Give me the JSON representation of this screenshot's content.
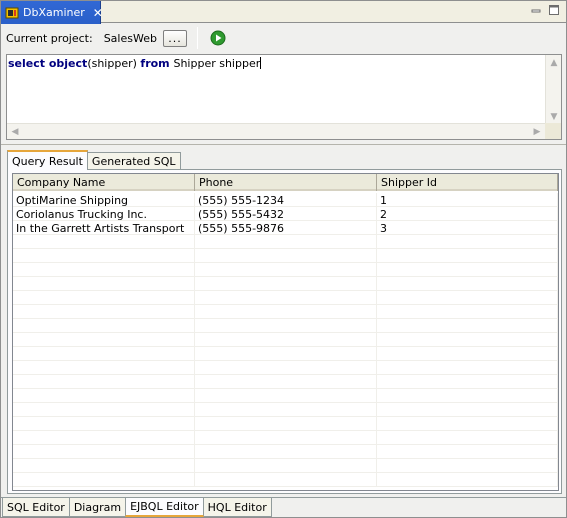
{
  "view": {
    "title": "DbXaminer",
    "close_glyph": "✕"
  },
  "toolbar": {
    "project_label": "Current project:",
    "project_name": "SalesWeb",
    "browse_label": "..."
  },
  "editor": {
    "tokens": [
      {
        "text": "select ",
        "kw": true
      },
      {
        "text": "object",
        "kw": true
      },
      {
        "text": "(shipper) ",
        "kw": false
      },
      {
        "text": "from ",
        "kw": true
      },
      {
        "text": "Shipper shipper",
        "kw": false
      }
    ]
  },
  "result_tabs": [
    {
      "label": "Query Result",
      "active": true
    },
    {
      "label": "Generated SQL",
      "active": false
    }
  ],
  "table": {
    "columns": [
      "Company Name",
      "Phone",
      "Shipper Id"
    ],
    "rows": [
      [
        "OptiMarine Shipping",
        "(555) 555-1234",
        "1"
      ],
      [
        "Coriolanus Trucking Inc.",
        "(555) 555-5432",
        "2"
      ],
      [
        "In the Garrett Artists Transport",
        "(555) 555-9876",
        "3"
      ]
    ]
  },
  "editor_tabs": [
    {
      "label": "SQL Editor",
      "active": false
    },
    {
      "label": "Diagram",
      "active": false
    },
    {
      "label": "EJBQL Editor",
      "active": true
    },
    {
      "label": "HQL Editor",
      "active": false
    }
  ],
  "icons": {
    "app": "database-icon",
    "run": "run-icon",
    "minimize": "minimize-icon",
    "maximize": "maximize-icon"
  },
  "colors": {
    "tab_active": "#3168d5",
    "keyword": "#00007f",
    "run_green": "#2f9a2f",
    "accent_tab": "#e6a63b"
  }
}
